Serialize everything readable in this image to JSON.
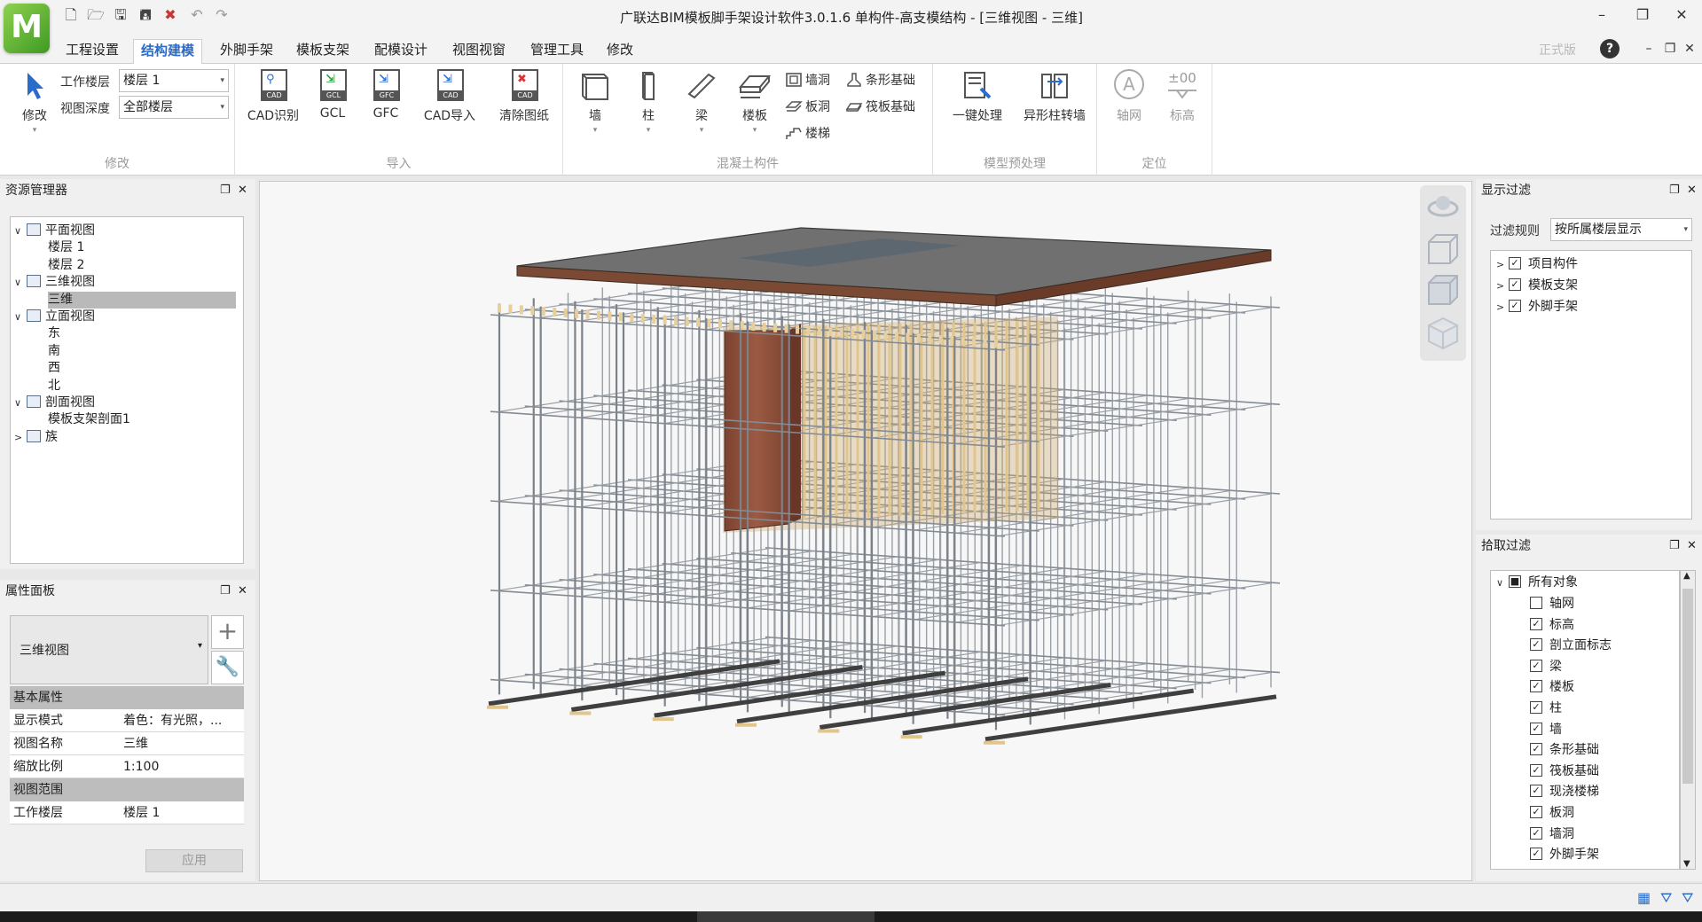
{
  "app": {
    "logo_letter": "M",
    "window_title": "广联达BIM模板脚手架设计软件3.0.1.6 单构件-高支模结构 - [三维视图 - 三维]",
    "edition_label": "正式版"
  },
  "quick_access": [
    "new-icon",
    "open-icon",
    "save-icon",
    "save-as-icon",
    "close-project-icon",
    "undo-icon",
    "redo-icon"
  ],
  "menu": {
    "tabs": [
      "工程设置",
      "结构建模",
      "外脚手架",
      "模板支架",
      "配模设计",
      "视图视窗",
      "管理工具",
      "修改"
    ],
    "active_tab": "结构建模"
  },
  "ribbon": {
    "modify": {
      "title": "修改",
      "modify_btn": "修改",
      "work_floor_label": "工作楼层",
      "work_floor_value": "楼层 1",
      "view_depth_label": "视图深度",
      "view_depth_value": "全部楼层"
    },
    "import": {
      "title": "导入",
      "cad_recognize": "CAD识别",
      "gcl": "GCL",
      "gfc": "GFC",
      "cad_import": "CAD导入",
      "clear_drawing": "清除图纸",
      "cad_tag": "CAD",
      "gcl_tag": "GCL",
      "gfc_tag": "GFC"
    },
    "concrete": {
      "title": "混凝土构件",
      "wall": "墙",
      "column": "柱",
      "beam": "梁",
      "slab": "楼板",
      "wall_opening": "墙洞",
      "slab_opening": "板洞",
      "stair": "楼梯",
      "strip_foundation": "条形基础",
      "raft_foundation": "筏板基础"
    },
    "preprocess": {
      "title": "模型预处理",
      "one_click": "一键处理",
      "irregular_column": "异形柱转墙"
    },
    "locate": {
      "title": "定位",
      "axis": "轴网",
      "axis_glyph": "A",
      "elevation": "标高",
      "elevation_glyph": "±00"
    }
  },
  "resource_manager": {
    "title": "资源管理器",
    "tree": [
      {
        "label": "平面视图",
        "level": 0,
        "expand": "∨",
        "icon": "plan-view-icon"
      },
      {
        "label": "楼层 1",
        "level": 1
      },
      {
        "label": "楼层 2",
        "level": 1
      },
      {
        "label": "三维视图",
        "level": 0,
        "expand": "∨",
        "icon": "3d-view-icon"
      },
      {
        "label": "三维",
        "level": 1,
        "selected": true
      },
      {
        "label": "立面视图",
        "level": 0,
        "expand": "∨",
        "icon": "elevation-view-icon"
      },
      {
        "label": "东",
        "level": 1
      },
      {
        "label": "南",
        "level": 1
      },
      {
        "label": "西",
        "level": 1
      },
      {
        "label": "北",
        "level": 1
      },
      {
        "label": "剖面视图",
        "level": 0,
        "expand": "∨",
        "icon": "section-view-icon"
      },
      {
        "label": "模板支架剖面1",
        "level": 1
      },
      {
        "label": "族",
        "level": 0,
        "expand": ">",
        "icon": "family-icon"
      }
    ]
  },
  "properties": {
    "title": "属性面板",
    "type_value": "三维视图",
    "sections": [
      {
        "name": "基本属性",
        "rows": [
          {
            "k": "显示模式",
            "v": "着色：有光照，..."
          },
          {
            "k": "视图名称",
            "v": "三维"
          },
          {
            "k": "缩放比例",
            "v": "1:100"
          }
        ]
      },
      {
        "name": "视图范围",
        "rows": [
          {
            "k": "工作楼层",
            "v": "楼层 1"
          }
        ]
      }
    ],
    "apply": "应用"
  },
  "display_filter": {
    "title": "显示过滤",
    "rule_label": "过滤规则",
    "rule_value": "按所属楼层显示",
    "items": [
      {
        "label": "项目构件",
        "checked": true
      },
      {
        "label": "模板支架",
        "checked": true
      },
      {
        "label": "外脚手架",
        "checked": true
      }
    ]
  },
  "pick_filter": {
    "title": "拾取过滤",
    "root": "所有对象",
    "items": [
      {
        "label": "轴网",
        "checked": false
      },
      {
        "label": "标高",
        "checked": true
      },
      {
        "label": "剖立面标志",
        "checked": true
      },
      {
        "label": "梁",
        "checked": true
      },
      {
        "label": "楼板",
        "checked": true
      },
      {
        "label": "柱",
        "checked": true
      },
      {
        "label": "墙",
        "checked": true
      },
      {
        "label": "条形基础",
        "checked": true
      },
      {
        "label": "筏板基础",
        "checked": true
      },
      {
        "label": "现浇楼梯",
        "checked": true
      },
      {
        "label": "板洞",
        "checked": true
      },
      {
        "label": "墙洞",
        "checked": true
      },
      {
        "label": "外脚手架",
        "checked": true
      }
    ]
  },
  "colors": {
    "accent": "#2a6cc9",
    "slab_top": "#6f6f6f",
    "slab_edge": "#7a4a34",
    "beam_face": "#8a4e37",
    "scaffold": "#8a8f96",
    "timber": "#e2c58b"
  }
}
